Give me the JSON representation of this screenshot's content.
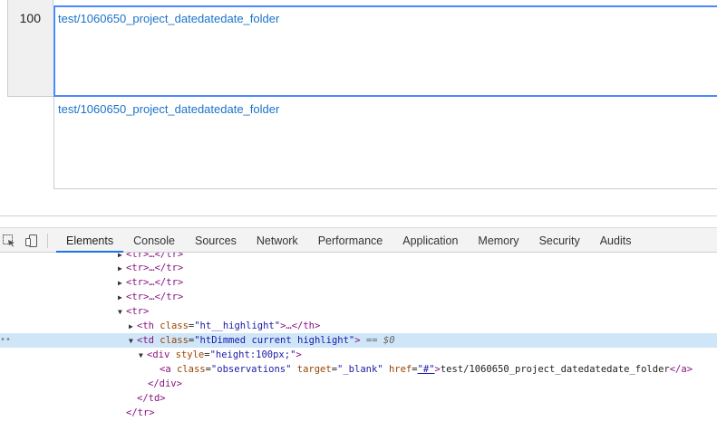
{
  "sheet": {
    "row_number": "100",
    "cell_link": "test/1060650_project_datedatedate_folder",
    "next_cell_link": "test/1060650_project_datedatedate_folder"
  },
  "devtools": {
    "tabs": [
      "Elements",
      "Console",
      "Sources",
      "Network",
      "Performance",
      "Application",
      "Memory",
      "Security",
      "Audits"
    ],
    "active_tab": "Elements",
    "dom": {
      "tr_collapsed": "<tr>…</tr>",
      "tr_open": "<tr>",
      "th_open": "<th",
      "th_attr": "class",
      "th_val": "\"ht__highlight\"",
      "th_close": ">…</th>",
      "td_open": "<td",
      "td_attr": "class",
      "td_val": "\"htDimmed current highlight\"",
      "td_close": ">",
      "selected_marker": "== $0",
      "div_open": "<div",
      "div_attr": "style",
      "div_val": "\"height:100px;\"",
      "div_close": ">",
      "a_open": "<a",
      "a_class_attr": "class",
      "a_class_val": "\"observations\"",
      "a_target_attr": "target",
      "a_target_val": "\"_blank\"",
      "a_href_attr": "href",
      "a_href_val": "\"#\"",
      "a_text": "test/1060650_project_datedatedate_folder",
      "a_end": "</a>",
      "div_end": "</div>",
      "td_end": "</td>",
      "tr_end": "</tr>",
      "dots": "••"
    }
  },
  "colors": {
    "link": "#1a73c8",
    "selection_border": "#4b89ff",
    "selected_line_bg": "#cfe6f9",
    "tag": "#881280",
    "attr_name": "#994500",
    "attr_value": "#1a1aa6"
  }
}
